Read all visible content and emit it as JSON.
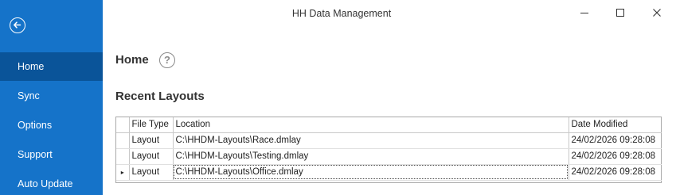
{
  "window": {
    "title": "HH Data Management"
  },
  "sidebar": {
    "items": [
      {
        "label": "Home"
      },
      {
        "label": "Sync"
      },
      {
        "label": "Options"
      },
      {
        "label": "Support"
      },
      {
        "label": "Auto Update"
      }
    ],
    "active": "Home"
  },
  "page": {
    "title": "Home",
    "help_glyph": "?"
  },
  "recent_layouts": {
    "title": "Recent Layouts",
    "columns": [
      "File Type",
      "Location",
      "Date Modified"
    ],
    "rows": [
      {
        "file_type": "Layout",
        "location": "C:\\HHDM-Layouts\\Race.dmlay",
        "date_modified": "24/02/2026 09:28:08"
      },
      {
        "file_type": "Layout",
        "location": "C:\\HHDM-Layouts\\Testing.dmlay",
        "date_modified": "24/02/2026 09:28:08"
      },
      {
        "file_type": "Layout",
        "location": "C:\\HHDM-Layouts\\Office.dmlay",
        "date_modified": "24/02/2026 09:28:08"
      }
    ],
    "current_row_marker": "▸"
  },
  "icons": {
    "back": "back-arrow-circle-icon",
    "minimize": "minimize-icon",
    "maximize": "maximize-icon",
    "close": "close-icon",
    "help": "help-icon"
  },
  "colors": {
    "sidebar": "#1573c9",
    "sidebar_active": "#0a5499",
    "text": "#333333"
  }
}
